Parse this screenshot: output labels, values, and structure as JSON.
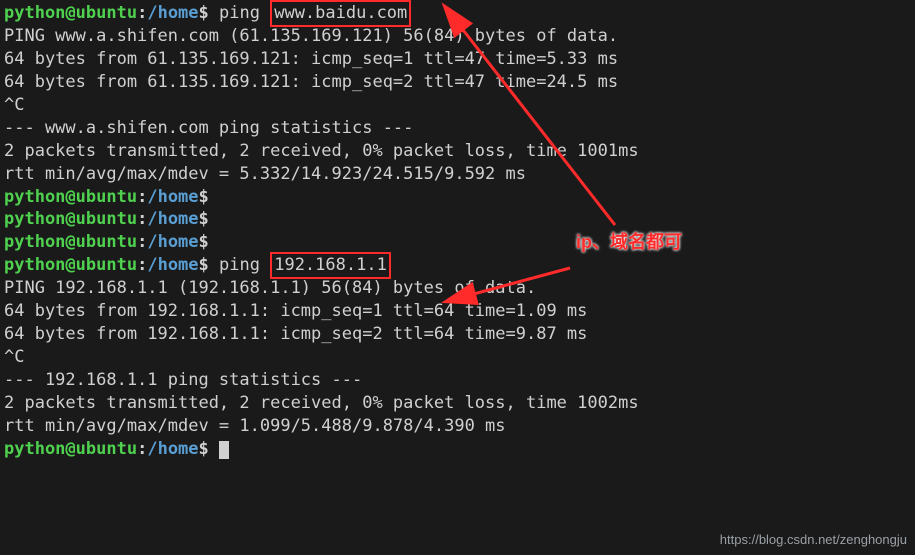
{
  "prompt": {
    "user": "python",
    "at": "@",
    "host": "ubuntu",
    "colon": ":",
    "path": "/home",
    "dollar": "$"
  },
  "cmd1_prefix": "ping ",
  "cmd1_target": "www.baidu.com",
  "out1": [
    "PING www.a.shifen.com (61.135.169.121) 56(84) bytes of data.",
    "64 bytes from 61.135.169.121: icmp_seq=1 ttl=47 time=5.33 ms",
    "64 bytes from 61.135.169.121: icmp_seq=2 ttl=47 time=24.5 ms",
    "^C",
    "--- www.a.shifen.com ping statistics ---",
    "2 packets transmitted, 2 received, 0% packet loss, time 1001ms",
    "rtt min/avg/max/mdev = 5.332/14.923/24.515/9.592 ms"
  ],
  "cmd2_prefix": "ping ",
  "cmd2_target": "192.168.1.1",
  "out2": [
    "PING 192.168.1.1 (192.168.1.1) 56(84) bytes of data.",
    "64 bytes from 192.168.1.1: icmp_seq=1 ttl=64 time=1.09 ms",
    "64 bytes from 192.168.1.1: icmp_seq=2 ttl=64 time=9.87 ms",
    "^C",
    "--- 192.168.1.1 ping statistics ---",
    "2 packets transmitted, 2 received, 0% packet loss, time 1002ms",
    "rtt min/avg/max/mdev = 1.099/5.488/9.878/4.390 ms"
  ],
  "annotation": "ip、域名都可",
  "watermark": "https://blog.csdn.net/zenghongju"
}
